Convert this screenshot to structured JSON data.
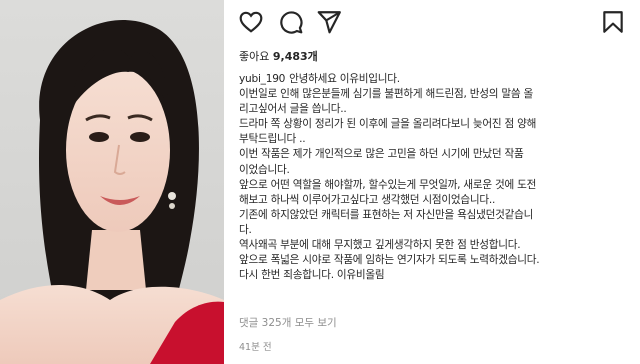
{
  "post": {
    "likes_label": "좋아요",
    "likes_count": "9,483개",
    "username": "yubi_190",
    "caption_first": "안녕하세요 이유비입니다.",
    "caption_lines": [
      " 이번일로 인해 많은분들께 심기를 불편하게 해드린점, 반성의 말씀 올",
      "리고싶어서 글을 씁니다..",
      "드라마 쪽 상황이 정리가 된 이후에 글을 올리려다보니 늦어진 점 양해",
      "부탁드립니다 ..",
      " 이번 작품은  제가 개인적으로 많은 고민을 하던 시기에 만났던 작품",
      "이었습니다.",
      "앞으로 어떤 역할을 해야할까, 할수있는게 무엇일까, 새로운 것에 도전",
      "해보고 하나씩 이루어가고싶다고 생각했던 시점이었습니다..",
      " 기존에 하지않았던 캐릭터를 표현하는 저 자신만을 욕심냈던것같습니",
      "다.",
      "역사왜곡 부분에 대해 무지했고 깊게생각하지 못한 점 반성합니다.",
      "앞으로 폭넓은 시야로 작품에 임하는 연기자가 되도록 노력하겠습니다.",
      "다시 한번 죄송합니다. 이유비올림"
    ],
    "comments_label": "댓글 325개 모두 보기",
    "time_ago": "41분 전"
  },
  "colors": {
    "text": "#262626",
    "muted": "#8e8e8e",
    "background": "#ffffff",
    "dress_red": "#c8102e"
  },
  "icons": [
    "heart-icon",
    "comment-icon",
    "share-icon",
    "bookmark-icon"
  ]
}
